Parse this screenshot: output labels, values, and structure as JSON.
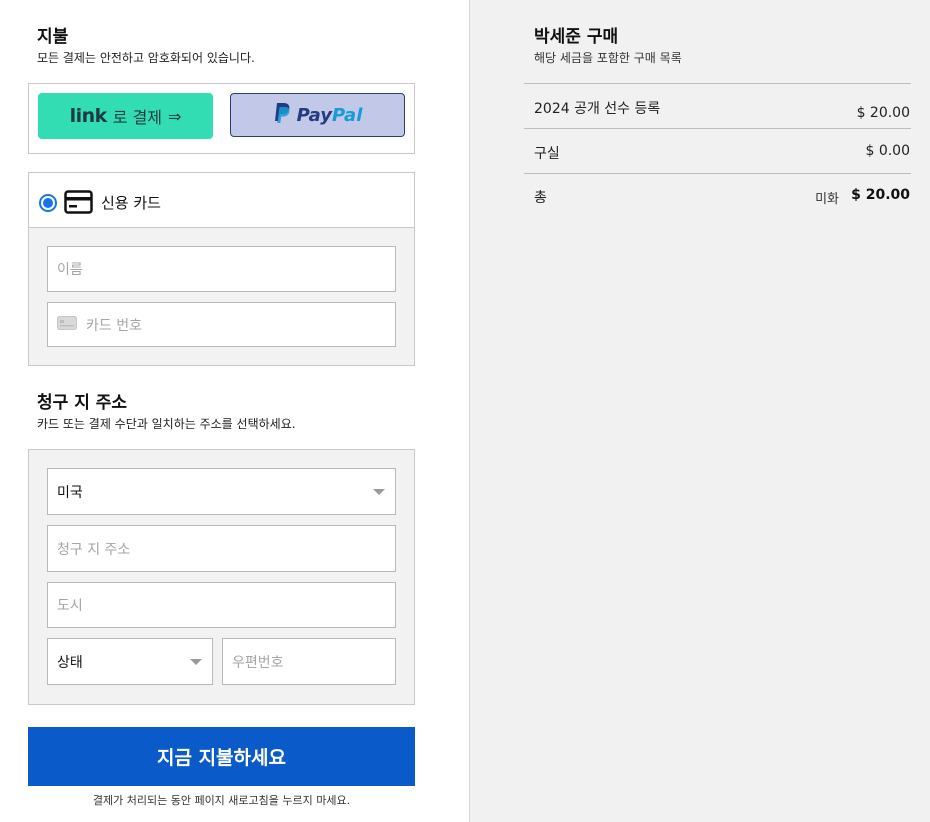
{
  "payment": {
    "title": "지불",
    "subtitle": "모든 결제는 안전하고 암호화되어 있습니다.",
    "link_button_logo": "link",
    "link_button_label": "로 결제",
    "link_button_arrow": "⇒",
    "paypal_label_dark": "Pay",
    "paypal_label_light": "Pal",
    "method_label": "신용 카드",
    "name_placeholder": "이름",
    "card_number_placeholder": "카드 번호"
  },
  "billing": {
    "title": "청구 지 주소",
    "subtitle": "카드 또는 결제 수단과 일치하는 주소를 선택하세요.",
    "country_value": "미국",
    "address_placeholder": "청구 지 주소",
    "city_placeholder": "도시",
    "state_value": "상태",
    "zip_placeholder": "우편번호"
  },
  "actions": {
    "pay_button": "지금 지불하세요",
    "notice": "결제가 처리되는 동안 페이지 새로고침을 누르지 마세요."
  },
  "summary": {
    "title": "박세준 구매",
    "subtitle": "해당 세금을 포함한 구매 목록",
    "items": [
      {
        "label": "2024 공개 선수 등록",
        "value": "$ 20.00"
      },
      {
        "label": "구실",
        "value": "$ 0.00"
      }
    ],
    "total_label": "총",
    "total_currency": "미화",
    "total_value": "$ 20.00"
  },
  "colors": {
    "link_green": "#33ddb3",
    "paypal_bg": "#c1c8e8",
    "pay_button_blue": "#0a5bc9",
    "radio_blue": "#1a73e8"
  }
}
